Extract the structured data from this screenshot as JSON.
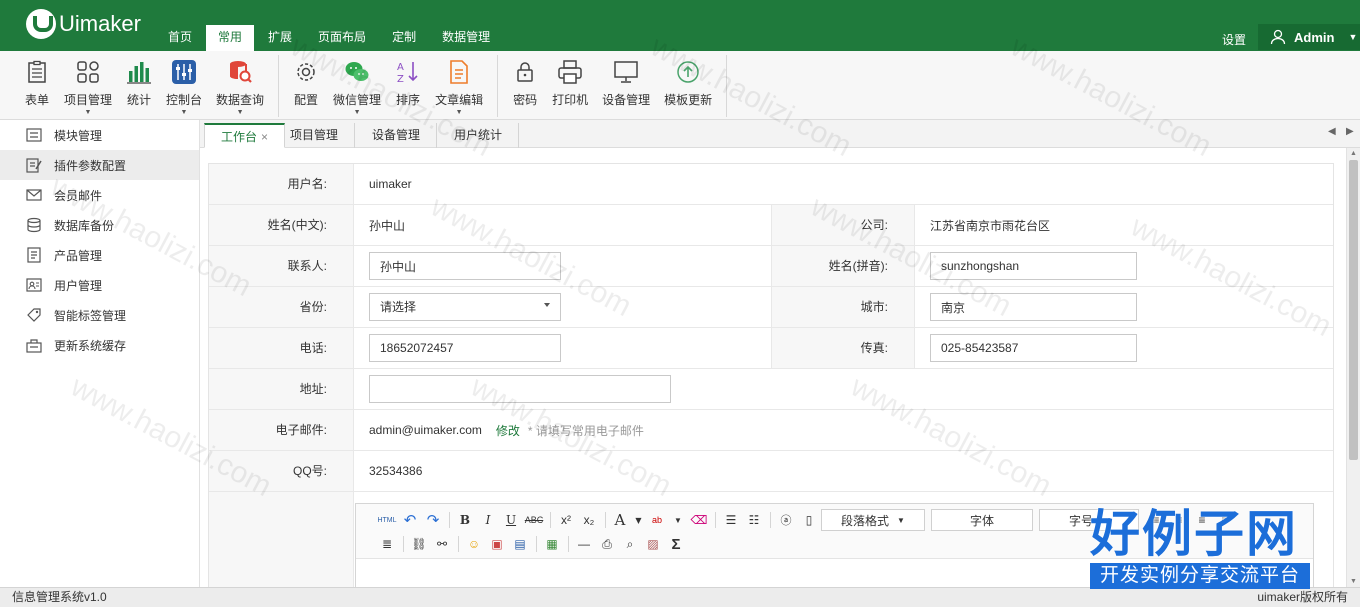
{
  "app": {
    "logo_text": "Uimaker",
    "brand_color": "#1f7a3c"
  },
  "top_nav": {
    "items": [
      {
        "label": "首页"
      },
      {
        "label": "常用"
      },
      {
        "label": "扩展"
      },
      {
        "label": "页面布局"
      },
      {
        "label": "定制"
      },
      {
        "label": "数据管理"
      }
    ],
    "active": "常用",
    "settings_label": "设置",
    "user_name": "Admin"
  },
  "toolbar": {
    "groups": [
      [
        {
          "label": "表单",
          "icon": "form-icon"
        },
        {
          "label": "项目管理",
          "icon": "grid-icon",
          "dropdown": true
        },
        {
          "label": "统计",
          "icon": "bar-chart-icon"
        },
        {
          "label": "控制台",
          "icon": "sliders-icon",
          "dropdown": true
        },
        {
          "label": "数据查询",
          "icon": "database-search-icon",
          "dropdown": true
        }
      ],
      [
        {
          "label": "配置",
          "icon": "gear-icon"
        },
        {
          "label": "微信管理",
          "icon": "wechat-icon",
          "dropdown": true
        },
        {
          "label": "排序",
          "icon": "sort-az-icon"
        },
        {
          "label": "文章编辑",
          "icon": "document-edit-icon",
          "dropdown": true
        }
      ],
      [
        {
          "label": "密码",
          "icon": "lock-icon"
        },
        {
          "label": "打印机",
          "icon": "printer-icon"
        },
        {
          "label": "设备管理",
          "icon": "monitor-icon"
        },
        {
          "label": "模板更新",
          "icon": "upload-circle-icon"
        }
      ]
    ]
  },
  "sidebar": {
    "items": [
      {
        "label": "模块管理",
        "icon": "module-icon"
      },
      {
        "label": "插件参数配置",
        "icon": "plugin-edit-icon"
      },
      {
        "label": "会员邮件",
        "icon": "mail-icon"
      },
      {
        "label": "数据库备份",
        "icon": "database-icon"
      },
      {
        "label": "产品管理",
        "icon": "product-icon"
      },
      {
        "label": "用户管理",
        "icon": "users-icon"
      },
      {
        "label": "智能标签管理",
        "icon": "tag-icon"
      },
      {
        "label": "更新系统缓存",
        "icon": "cache-icon"
      }
    ],
    "active_index": 1
  },
  "tabs": {
    "items": [
      {
        "label": "工作台",
        "closable": true
      },
      {
        "label": "项目管理"
      },
      {
        "label": "设备管理"
      },
      {
        "label": "用户统计"
      }
    ],
    "active_index": 0
  },
  "form": {
    "username": {
      "label": "用户名:",
      "value": "uimaker"
    },
    "name_cn": {
      "label": "姓名(中文):",
      "value": "孙中山"
    },
    "company": {
      "label": "公司:",
      "value": "江苏省南京市雨花台区"
    },
    "contact": {
      "label": "联系人:",
      "value": "孙中山"
    },
    "name_pinyin": {
      "label": "姓名(拼音):",
      "value": "sunzhongshan"
    },
    "province": {
      "label": "省份:",
      "value": "请选择"
    },
    "city": {
      "label": "城市:",
      "value": "南京"
    },
    "phone": {
      "label": "电话:",
      "value": "18652072457"
    },
    "fax": {
      "label": "传真:",
      "value": "025-85423587"
    },
    "address": {
      "label": "地址:",
      "value": ""
    },
    "email": {
      "label": "电子邮件:",
      "value": "admin@uimaker.com",
      "edit_label": "修改",
      "hint": "* 请填写常用电子邮件"
    },
    "qq": {
      "label": "QQ号:",
      "value": "32534386"
    }
  },
  "editor": {
    "paragraph_label": "段落格式",
    "font_label": "字体",
    "size_label": "字号"
  },
  "status": {
    "left": "信息管理系统v1.0",
    "right": "uimaker版权所有"
  },
  "watermark": {
    "text": "www.haolizi.com",
    "brand_title": "好例子网",
    "brand_subtitle": "开发实例分享交流平台"
  }
}
